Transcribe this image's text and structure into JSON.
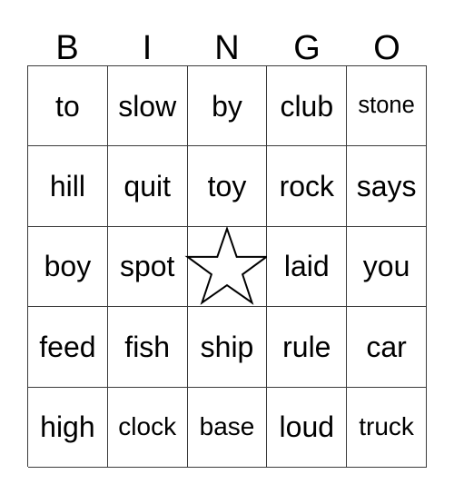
{
  "card": {
    "title": "BINGO",
    "headers": [
      "B",
      "I",
      "N",
      "G",
      "O"
    ],
    "free_space_icon": "star-icon",
    "colors": {
      "background": "#ffffff",
      "text": "#000000",
      "grid_line": "#3b3b3b"
    },
    "rows": [
      [
        {
          "text": "to",
          "size": "lg"
        },
        {
          "text": "slow",
          "size": "lg"
        },
        {
          "text": "by",
          "size": "lg"
        },
        {
          "text": "club",
          "size": "lg"
        },
        {
          "text": "stone",
          "size": "xs"
        }
      ],
      [
        {
          "text": "hill",
          "size": "lg"
        },
        {
          "text": "quit",
          "size": "lg"
        },
        {
          "text": "toy",
          "size": "lg"
        },
        {
          "text": "rock",
          "size": "lg"
        },
        {
          "text": "says",
          "size": "lg"
        }
      ],
      [
        {
          "text": "boy",
          "size": "lg"
        },
        {
          "text": "spot",
          "size": "lg"
        },
        {
          "text": "",
          "size": "lg",
          "free": true
        },
        {
          "text": "laid",
          "size": "lg"
        },
        {
          "text": "you",
          "size": "lg"
        }
      ],
      [
        {
          "text": "feed",
          "size": "lg"
        },
        {
          "text": "fish",
          "size": "lg"
        },
        {
          "text": "ship",
          "size": "lg"
        },
        {
          "text": "rule",
          "size": "lg"
        },
        {
          "text": "car",
          "size": "lg"
        }
      ],
      [
        {
          "text": "high",
          "size": "lg"
        },
        {
          "text": "clock",
          "size": "sm"
        },
        {
          "text": "base",
          "size": "sm"
        },
        {
          "text": "loud",
          "size": "lg"
        },
        {
          "text": "truck",
          "size": "sm"
        }
      ]
    ]
  }
}
